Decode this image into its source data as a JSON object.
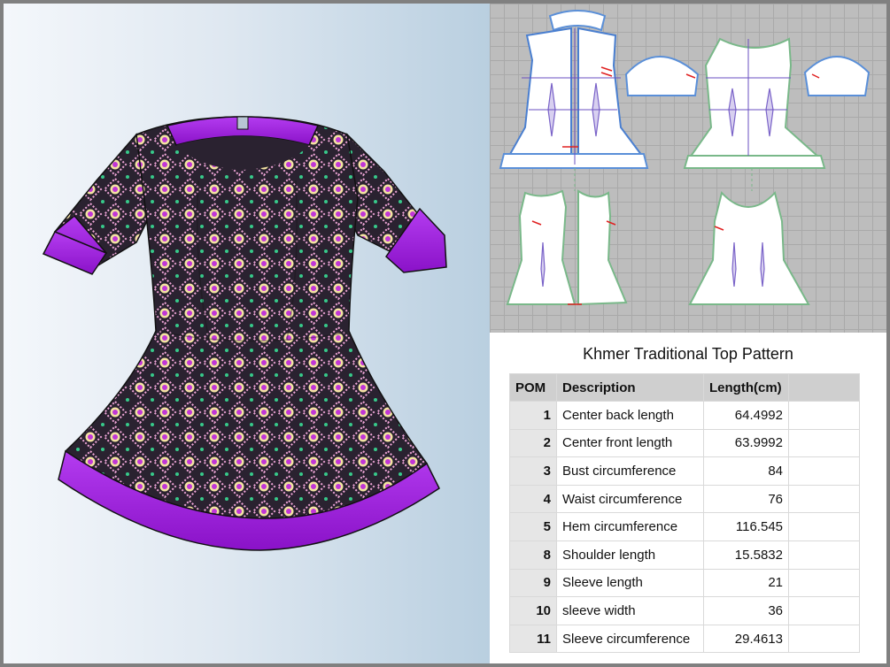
{
  "table_title": "Khmer Traditional Top Pattern",
  "headers": {
    "pom": "POM",
    "description": "Description",
    "length": "Length(cm)"
  },
  "rows": [
    {
      "pom": "1",
      "description": "Center back length",
      "length": "64.4992"
    },
    {
      "pom": "2",
      "description": "Center front length",
      "length": "63.9992"
    },
    {
      "pom": "3",
      "description": "Bust circumference",
      "length": "84"
    },
    {
      "pom": "4",
      "description": "Waist circumference",
      "length": "76"
    },
    {
      "pom": "5",
      "description": "Hem circumference",
      "length": "116.545"
    },
    {
      "pom": "8",
      "description": "Shoulder length",
      "length": "15.5832"
    },
    {
      "pom": "9",
      "description": "Sleeve length",
      "length": "21"
    },
    {
      "pom": "10",
      "description": "sleeve width",
      "length": "36"
    },
    {
      "pom": "11",
      "description": "Sleeve circumference",
      "length": "29.4613"
    }
  ],
  "colors": {
    "trim": "#a51ee6",
    "fabric": "#2a2230",
    "pattern_bg": "#bdbdbd",
    "table_header": "#cfcfcf"
  }
}
